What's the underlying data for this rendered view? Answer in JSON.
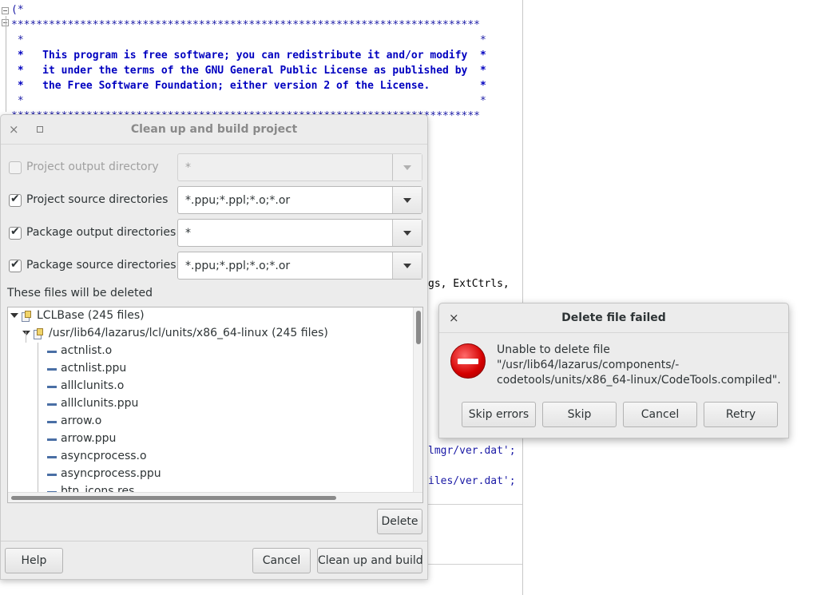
{
  "editor": {
    "code_lines": [
      "(*",
      "***************************************************************************",
      " *                                                                         *",
      " *   This program is free software; you can redistribute it and/or modify  *",
      " *   it under the terms of the GNU General Public License as published by  *",
      " *   the Free Software Foundation; either version 2 of the License.        *",
      " *                                                                         *",
      "***************************************************************************"
    ],
    "frag_extctrls": "gs, ExtCtrls,",
    "frag_ver1": "lmgr/ver.dat';",
    "frag_ver2": "iles/ver.dat';"
  },
  "cleanup_dialog": {
    "title": "Clean up and build project",
    "options": [
      {
        "label": "Project output directory",
        "checked": false,
        "enabled": false,
        "value": "*"
      },
      {
        "label": "Project source directories",
        "checked": true,
        "enabled": true,
        "value": "*.ppu;*.ppl;*.o;*.or"
      },
      {
        "label": "Package output directories",
        "checked": true,
        "enabled": true,
        "value": "*"
      },
      {
        "label": "Package source directories",
        "checked": true,
        "enabled": true,
        "value": "*.ppu;*.ppl;*.o;*.or"
      }
    ],
    "files_label": "These files will be deleted",
    "tree": {
      "root": "LCLBase (245 files)",
      "dir": "/usr/lib64/lazarus/lcl/units/x86_64-linux (245 files)",
      "files": [
        "actnlist.o",
        "actnlist.ppu",
        "alllclunits.o",
        "alllclunits.ppu",
        "arrow.o",
        "arrow.ppu",
        "asyncprocess.o",
        "asyncprocess.ppu",
        "btn_icons.res"
      ]
    },
    "delete_label": "Delete",
    "help_label": "Help",
    "cancel_label": "Cancel",
    "build_label": "Clean up and build"
  },
  "error_dialog": {
    "title": "Delete file failed",
    "message": "Unable to delete file \"/usr/lib64/lazarus/components/-codetools/units/x86_64-linux/CodeTools.compiled\".",
    "icon": "stop-icon",
    "buttons": {
      "skip_errors": "Skip errors",
      "skip": "Skip",
      "cancel": "Cancel",
      "retry": "Retry"
    }
  },
  "glyphs": {
    "close": "×",
    "check": "✔"
  }
}
